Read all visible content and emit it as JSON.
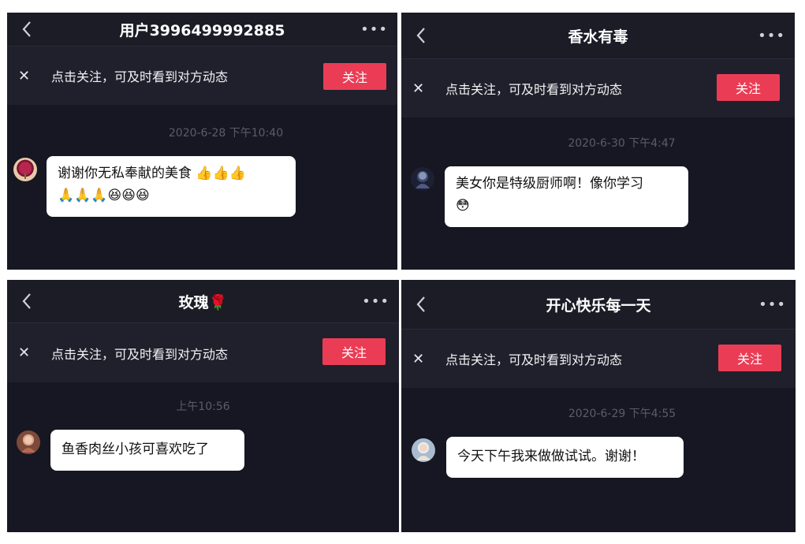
{
  "panels": [
    {
      "title": "用户3996499992885",
      "back_glyph": "‹",
      "more_glyph": "•••",
      "close_glyph": "✕",
      "notice": "点击关注，可及时看到对方动态",
      "follow_label": "关注",
      "timestamp": "2020-6-28 下午10:40",
      "message": "谢谢你无私奉献的美食",
      "message_line2": "",
      "emoji_line1": "👍👍👍",
      "emoji_line2": "🙏🙏🙏😆😆😆",
      "avatar_icon": "rose-avatar"
    },
    {
      "title": "香水有毒",
      "back_glyph": "‹",
      "more_glyph": "•••",
      "close_glyph": "✕",
      "notice": "点击关注，可及时看到对方动态",
      "follow_label": "关注",
      "timestamp": "2020-6-30 下午4:47",
      "message": "美女你是特级厨师啊！像你学习",
      "emoji_line2": "😳",
      "avatar_icon": "dark-avatar"
    },
    {
      "title": "玫瑰",
      "title_emoji": "🌹",
      "back_glyph": "‹",
      "more_glyph": "•••",
      "close_glyph": "✕",
      "notice": "点击关注，可及时看到对方动态",
      "follow_label": "关注",
      "timestamp": "上午10:56",
      "message": "鱼香肉丝小孩可喜欢吃了",
      "avatar_icon": "woman-avatar"
    },
    {
      "title": "开心快乐每一天",
      "back_glyph": "‹",
      "more_glyph": "•••",
      "close_glyph": "✕",
      "notice": "点击关注，可及时看到对方动态",
      "follow_label": "关注",
      "timestamp": "2020-6-29 下午4:55",
      "message": "今天下午我来做做试试。谢谢！",
      "avatar_icon": "girl-avatar"
    }
  ],
  "colors": {
    "panel_bg": "#161722",
    "follow_button": "#ea3d55",
    "timestamp": "#5a5c6a"
  }
}
